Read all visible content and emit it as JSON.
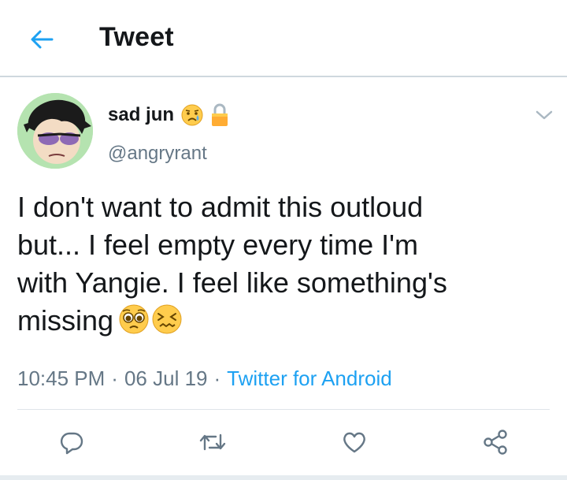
{
  "header": {
    "title": "Tweet",
    "back_icon": "arrow-left-icon",
    "accent_color": "#1da1f2"
  },
  "tweet": {
    "author": {
      "display_name": "sad jun",
      "name_emojis": [
        "sad-but-relieved-face-emoji",
        "lock-icon"
      ],
      "handle": "@angryrant"
    },
    "text_lines": [
      "I don't want to admit this outloud",
      "but... I feel empty every time I'm",
      "with Yangie. I feel like something's",
      "missing"
    ],
    "text_emojis": [
      "pleading-face-emoji",
      "confounded-face-emoji"
    ],
    "time": "10:45 PM",
    "date": "06 Jul 19",
    "separator": "·",
    "source": "Twitter for Android"
  },
  "actions": [
    {
      "name": "reply",
      "icon": "reply-icon"
    },
    {
      "name": "retweet",
      "icon": "retweet-icon"
    },
    {
      "name": "like",
      "icon": "heart-icon"
    },
    {
      "name": "share",
      "icon": "share-icon"
    }
  ],
  "colors": {
    "text": "#14171a",
    "secondary": "#657786",
    "link": "#1da1f2",
    "divider": "#cfd8de"
  }
}
